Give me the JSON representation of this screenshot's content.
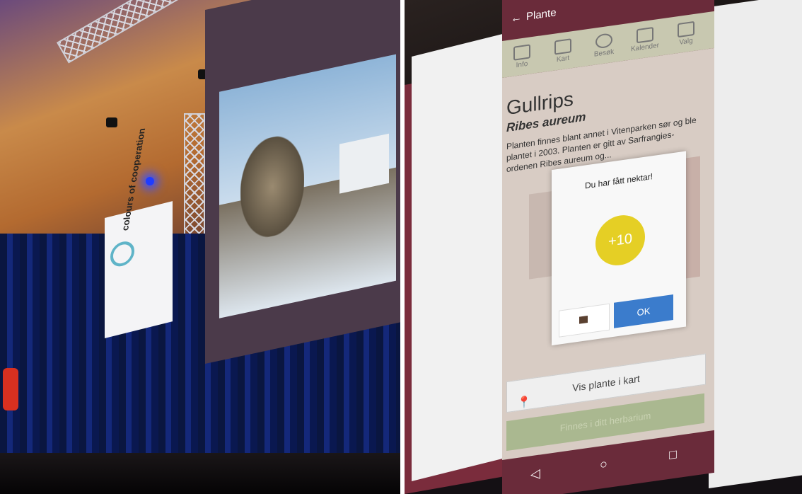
{
  "left_photo": {
    "logo_text": "colours of cooperation"
  },
  "app": {
    "header_title": "Plante",
    "tabs": [
      {
        "label": "Info"
      },
      {
        "label": "Kart"
      },
      {
        "label": "Besøk"
      },
      {
        "label": "Kalender"
      },
      {
        "label": "Valg"
      }
    ],
    "plant_name": "Gullrips",
    "latin_name": "Ribes aureum",
    "description": "Planten finnes blant annet i Vitenparken sør og ble plantet i 2003. Planten er gitt av Sarfrangies-ordenen Ribes aureum og...",
    "dialog": {
      "title": "Du har fått nektar!",
      "points": "+10",
      "ok_label": "OK"
    },
    "map_button": "Vis plante i kart",
    "herbarium_button": "Finnes i ditt herbarium",
    "colors": {
      "header": "#6a2b3a",
      "coin": "#e5cf25",
      "ok": "#3b7ccc"
    }
  }
}
